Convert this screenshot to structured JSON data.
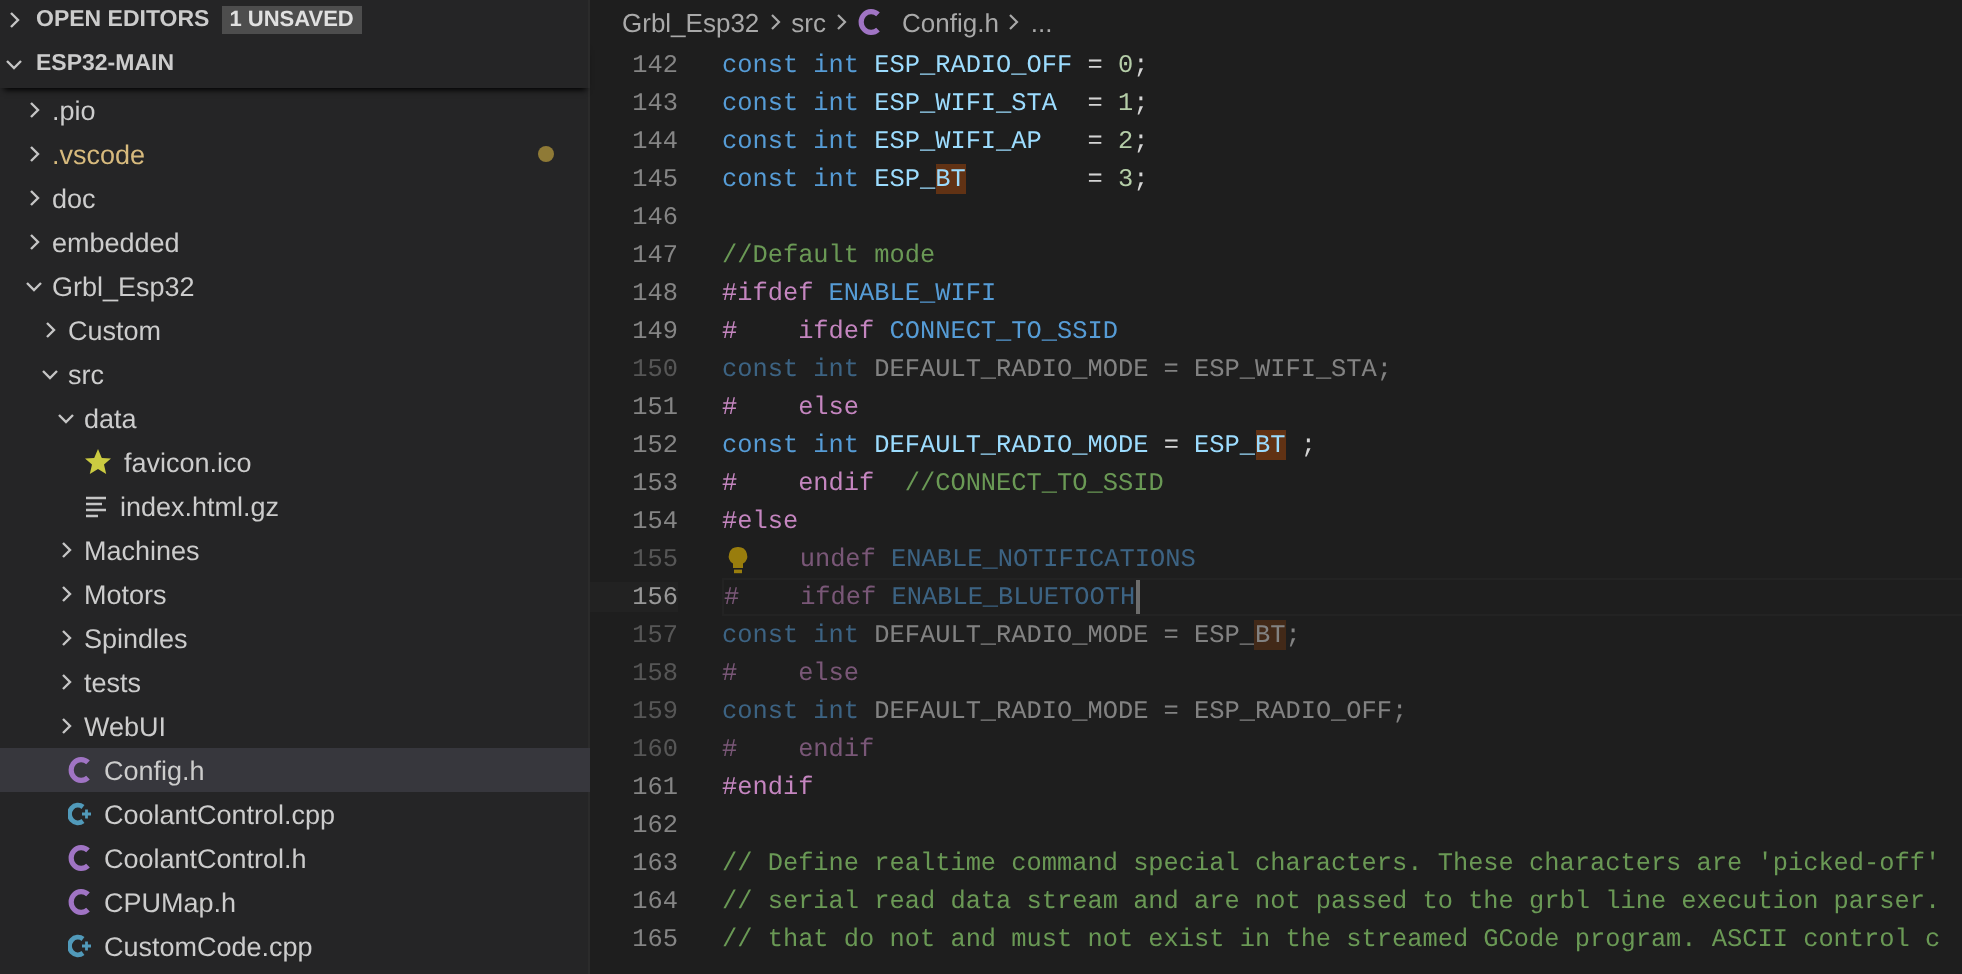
{
  "sidebar": {
    "open_editors": {
      "label": "OPEN EDITORS",
      "expanded": false,
      "badge": "1 UNSAVED"
    },
    "folder": {
      "label": "ESP32-MAIN",
      "expanded": true
    },
    "tree": [
      {
        "name": ".pio",
        "kind": "folder",
        "expanded": false,
        "selected": false,
        "modified": false
      },
      {
        "name": ".vscode",
        "kind": "folder",
        "expanded": false,
        "selected": false,
        "modified": true
      },
      {
        "name": "doc",
        "kind": "folder",
        "expanded": false,
        "selected": false,
        "modified": false
      },
      {
        "name": "embedded",
        "kind": "folder",
        "expanded": false,
        "selected": false,
        "modified": false
      },
      {
        "name": "Grbl_Esp32",
        "kind": "folder",
        "expanded": true,
        "selected": false,
        "modified": false,
        "children": [
          {
            "name": "Custom",
            "kind": "folder",
            "expanded": false,
            "selected": false,
            "modified": false
          },
          {
            "name": "src",
            "kind": "folder",
            "expanded": true,
            "selected": false,
            "modified": false,
            "children": [
              {
                "name": "data",
                "kind": "folder",
                "expanded": true,
                "selected": false,
                "modified": false,
                "children": [
                  {
                    "name": "favicon.ico",
                    "kind": "ico",
                    "selected": false,
                    "modified": false
                  },
                  {
                    "name": "index.html.gz",
                    "kind": "text",
                    "selected": false,
                    "modified": false
                  }
                ]
              },
              {
                "name": "Machines",
                "kind": "folder",
                "expanded": false,
                "selected": false,
                "modified": false
              },
              {
                "name": "Motors",
                "kind": "folder",
                "expanded": false,
                "selected": false,
                "modified": false
              },
              {
                "name": "Spindles",
                "kind": "folder",
                "expanded": false,
                "selected": false,
                "modified": false
              },
              {
                "name": "tests",
                "kind": "folder",
                "expanded": false,
                "selected": false,
                "modified": false
              },
              {
                "name": "WebUI",
                "kind": "folder",
                "expanded": false,
                "selected": false,
                "modified": false
              },
              {
                "name": "Config.h",
                "kind": "c",
                "selected": true,
                "modified": false
              },
              {
                "name": "CoolantControl.cpp",
                "kind": "cpp",
                "selected": false,
                "modified": false
              },
              {
                "name": "CoolantControl.h",
                "kind": "c",
                "selected": false,
                "modified": false
              },
              {
                "name": "CPUMap.h",
                "kind": "c",
                "selected": false,
                "modified": false
              },
              {
                "name": "CustomCode.cpp",
                "kind": "cpp",
                "selected": false,
                "modified": false
              }
            ]
          }
        ]
      }
    ]
  },
  "breadcrumb": [
    {
      "label": "Grbl_Esp32",
      "kind": "folder"
    },
    {
      "label": "src",
      "kind": "folder"
    },
    {
      "label": "Config.h",
      "kind": "c"
    },
    {
      "label": "...",
      "kind": "more"
    }
  ],
  "editor": {
    "lines": [
      {
        "number": "142",
        "dimmed": false,
        "current": false,
        "tokens": [
          {
            "kind": "keyword",
            "text": "const int "
          },
          {
            "kind": "identifier",
            "text": "ESP_RADIO_OFF"
          },
          {
            "kind": "punct",
            "text": " = "
          },
          {
            "kind": "number",
            "text": "0"
          },
          {
            "kind": "punct",
            "text": ";"
          }
        ]
      },
      {
        "number": "143",
        "dimmed": false,
        "current": false,
        "tokens": [
          {
            "kind": "keyword",
            "text": "const int "
          },
          {
            "kind": "identifier",
            "text": "ESP_WIFI_STA"
          },
          {
            "kind": "punct",
            "text": "  = "
          },
          {
            "kind": "number",
            "text": "1"
          },
          {
            "kind": "punct",
            "text": ";"
          }
        ]
      },
      {
        "number": "144",
        "dimmed": false,
        "current": false,
        "tokens": [
          {
            "kind": "keyword",
            "text": "const int "
          },
          {
            "kind": "identifier",
            "text": "ESP_WIFI_AP"
          },
          {
            "kind": "punct",
            "text": "   = "
          },
          {
            "kind": "number",
            "text": "2"
          },
          {
            "kind": "punct",
            "text": ";"
          }
        ]
      },
      {
        "number": "145",
        "dimmed": false,
        "current": false,
        "tokens": [
          {
            "kind": "keyword",
            "text": "const int "
          },
          {
            "kind": "identifier",
            "text": "ESP_"
          },
          {
            "kind": "identifier",
            "text": "BT",
            "highlight": true
          },
          {
            "kind": "punct",
            "text": "        = "
          },
          {
            "kind": "number",
            "text": "3"
          },
          {
            "kind": "punct",
            "text": ";"
          }
        ]
      },
      {
        "number": "146",
        "dimmed": false,
        "current": false
      },
      {
        "number": "147",
        "dimmed": false,
        "current": false,
        "tokens": [
          {
            "kind": "comment",
            "text": "//Default mode"
          }
        ]
      },
      {
        "number": "148",
        "dimmed": false,
        "current": false,
        "tokens": [
          {
            "kind": "directive",
            "text": "#ifdef"
          },
          {
            "kind": "macro",
            "text": " ENABLE_WIFI"
          }
        ]
      },
      {
        "number": "149",
        "dimmed": false,
        "current": false,
        "tokens": [
          {
            "kind": "directive",
            "text": "#    ifdef"
          },
          {
            "kind": "macro",
            "text": " CONNECT_TO_SSID"
          }
        ]
      },
      {
        "number": "150",
        "dimmed": true,
        "current": false,
        "tokens": [
          {
            "kind": "keyword",
            "text": "const int "
          },
          {
            "kind": "plain",
            "text": "DEFAULT_RADIO_MODE = ESP_WIFI_STA;"
          }
        ]
      },
      {
        "number": "151",
        "dimmed": false,
        "current": false,
        "tokens": [
          {
            "kind": "directive",
            "text": "#    else"
          }
        ]
      },
      {
        "number": "152",
        "dimmed": false,
        "current": false,
        "tokens": [
          {
            "kind": "keyword",
            "text": "const int "
          },
          {
            "kind": "identifier",
            "text": "DEFAULT_RADIO_MODE"
          },
          {
            "kind": "punct",
            "text": " = "
          },
          {
            "kind": "identifier",
            "text": "ESP_"
          },
          {
            "kind": "identifier",
            "text": "BT",
            "highlight": true
          },
          {
            "kind": "punct",
            "text": " ;"
          }
        ]
      },
      {
        "number": "153",
        "dimmed": false,
        "current": false,
        "tokens": [
          {
            "kind": "directive",
            "text": "#    endif"
          },
          {
            "kind": "comment",
            "text": "  //CONNECT_TO_SSID"
          }
        ]
      },
      {
        "number": "154",
        "dimmed": false,
        "current": false,
        "tokens": [
          {
            "kind": "directive",
            "text": "#else"
          }
        ]
      },
      {
        "number": "155",
        "dimmed": true,
        "current": false,
        "lightbulb": true,
        "tokens": [
          {
            "kind": "directive",
            "text": "   undef"
          },
          {
            "kind": "macro",
            "text": " ENABLE_NOTIFICATIONS"
          }
        ]
      },
      {
        "number": "156",
        "dimmed": true,
        "current": true,
        "tokens": [
          {
            "kind": "directive",
            "text": "#    ifdef"
          },
          {
            "kind": "macro",
            "text": " ENABLE_BLUETOOTH"
          }
        ]
      },
      {
        "number": "157",
        "dimmed": true,
        "current": false,
        "tokens": [
          {
            "kind": "keyword",
            "text": "const int "
          },
          {
            "kind": "plain",
            "text": "DEFAULT_RADIO_MODE = ESP_"
          },
          {
            "kind": "plain",
            "text": "BT",
            "highlight": true
          },
          {
            "kind": "plain",
            "text": ";"
          }
        ]
      },
      {
        "number": "158",
        "dimmed": true,
        "current": false,
        "tokens": [
          {
            "kind": "directive",
            "text": "#    else"
          }
        ]
      },
      {
        "number": "159",
        "dimmed": true,
        "current": false,
        "tokens": [
          {
            "kind": "keyword",
            "text": "const int "
          },
          {
            "kind": "plain",
            "text": "DEFAULT_RADIO_MODE = ESP_RADIO_OFF;"
          }
        ]
      },
      {
        "number": "160",
        "dimmed": true,
        "current": false,
        "tokens": [
          {
            "kind": "directive",
            "text": "#    endif"
          }
        ]
      },
      {
        "number": "161",
        "dimmed": false,
        "current": false,
        "tokens": [
          {
            "kind": "directive",
            "text": "#endif"
          }
        ]
      },
      {
        "number": "162",
        "dimmed": false,
        "current": false
      },
      {
        "number": "163",
        "dimmed": false,
        "current": false,
        "tokens": [
          {
            "kind": "comment",
            "text": "// Define realtime command special characters. These characters are 'picked-off'"
          }
        ]
      },
      {
        "number": "164",
        "dimmed": false,
        "current": false,
        "tokens": [
          {
            "kind": "comment",
            "text": "// serial read data stream and are not passed to the grbl line execution parser."
          }
        ]
      },
      {
        "number": "165",
        "dimmed": false,
        "current": false,
        "tokens": [
          {
            "kind": "comment",
            "text": "// that do not and must not exist in the streamed GCode program. ASCII control c"
          }
        ]
      }
    ]
  }
}
